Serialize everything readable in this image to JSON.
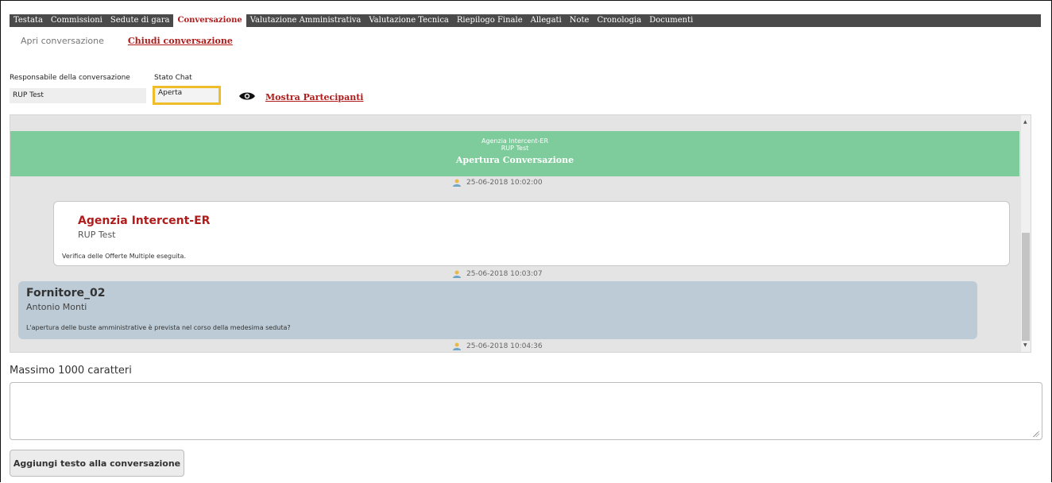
{
  "tabs": [
    {
      "label": "Testata",
      "active": false
    },
    {
      "label": "Commissioni",
      "active": false
    },
    {
      "label": "Sedute di gara",
      "active": false
    },
    {
      "label": "Conversazione",
      "active": true
    },
    {
      "label": "Valutazione Amministrativa",
      "active": false
    },
    {
      "label": "Valutazione Tecnica",
      "active": false
    },
    {
      "label": "Riepilogo Finale",
      "active": false
    },
    {
      "label": "Allegati",
      "active": false
    },
    {
      "label": "Note",
      "active": false
    },
    {
      "label": "Cronologia",
      "active": false
    },
    {
      "label": "Documenti",
      "active": false
    }
  ],
  "subnav": {
    "open": "Apri conversazione",
    "close": "Chiudi conversazione"
  },
  "fields": {
    "responsabile_label": "Responsabile della conversazione",
    "responsabile_value": "RUP Test",
    "stato_label": "Stato Chat",
    "stato_value": "Aperta"
  },
  "mostra": "Mostra Partecipanti",
  "chat": {
    "opening": {
      "org": "Agenzia Intercent-ER",
      "user": "RUP Test",
      "title": "Apertura Conversazione",
      "timestamp": "25-06-2018 10:02:00"
    },
    "messages": [
      {
        "org": "Agenzia Intercent-ER",
        "user": "RUP Test",
        "text": "Verifica delle Offerte Multiple eseguita.",
        "timestamp": "25-06-2018 10:03:07"
      },
      {
        "org": "Fornitore_02",
        "user": "Antonio Monti",
        "text": "L'apertura delle buste amministrative è prevista nel corso della medesima seduta?",
        "timestamp": "25-06-2018 10:04:36"
      }
    ]
  },
  "input": {
    "max_label": "Massimo 1000 caratteri",
    "value": ""
  },
  "button_label": "Aggiungi testo alla conversazione",
  "colors": {
    "accent": "#b01c1c",
    "opening_band": "#7ecb9b",
    "highlight": "#f0bd2a"
  }
}
